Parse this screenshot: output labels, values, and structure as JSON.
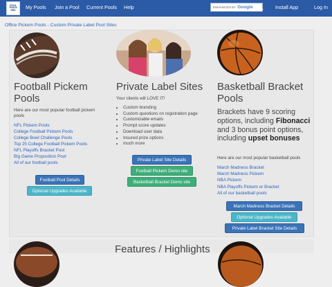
{
  "topbar": {
    "logo_lines": [
      "POOL",
      "TRACK",
      "ERS"
    ],
    "nav": [
      "My Pools",
      "Join a Pool",
      "Current Pools",
      "Help"
    ],
    "search_prefix": "ENHANCED BY",
    "search_brand": "Google",
    "install": "Install App",
    "login": "Log In"
  },
  "breadcrumb": "Office Pickem Pools - Custom Private Label Pool Sites",
  "football": {
    "heading": "Football Pickem Pools",
    "intro": "Here are our most popular football pickem pools",
    "links": [
      "NFL Pickem Pools",
      "College Football Pickem Pools",
      "College Bowl Challenge Pools",
      "Top 25 College Football Pickem Pools",
      "NFL Playoffs Bracket Pool",
      "Big Game Proposition Pool",
      "All of our football pools"
    ],
    "buttons": [
      "Football Pool Details",
      "Optional Upgrades Available"
    ]
  },
  "private": {
    "heading": "Private Label Sites",
    "intro": "Your clients will LOVE IT!",
    "features": [
      "Custom branding",
      "Custom questions on registration page",
      "Customizable emails",
      "Prompt score updates",
      "Download user data",
      "Insured prize options",
      "much more"
    ],
    "buttons": [
      "Private Label Site Details",
      "Football Pickem Demo site",
      "Basketball Bracket Demo site"
    ]
  },
  "basketball": {
    "heading": "Basketball Bracket Pools",
    "pitch_1": "Brackets have 9 scoring options, including ",
    "pitch_bold_1": "Fibonacci",
    "pitch_2": " and 3 bonus point options, including ",
    "pitch_bold_2": "upset bonuses",
    "intro": "Here are our most popular basketball pools",
    "links": [
      "March Madness Bracket",
      "March Madness Pickem",
      "NBA Pickem",
      "NBA Playoffs Pickem or Bracket",
      "All of our basketball pools"
    ],
    "buttons": [
      "March Madness Bracket Details",
      "Optional Upgrades Available",
      "Private Label Bracket Site Details"
    ]
  },
  "footer_heading": "Features / Highlights",
  "colors": {
    "nav_bg": "#2b5aa6",
    "link": "#2b60c0",
    "btn_blue": "#3b73b8",
    "btn_teal": "#4bb6c9",
    "btn_green": "#3fae7a"
  }
}
